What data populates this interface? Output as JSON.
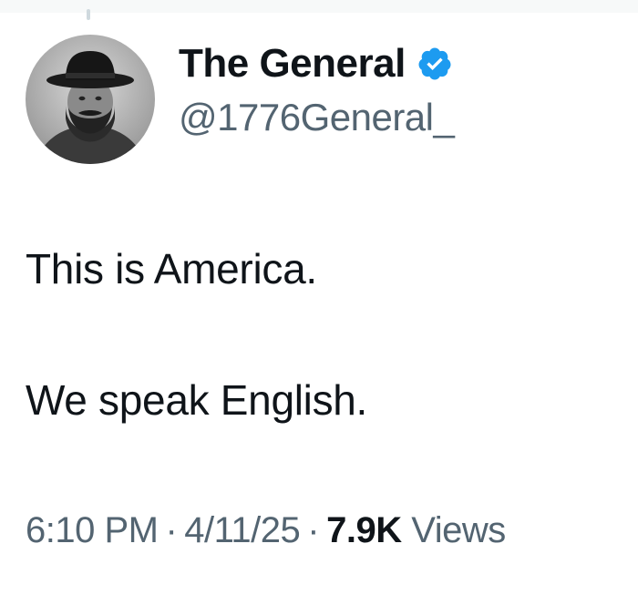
{
  "author": {
    "display_name": "The General",
    "handle": "@1776General_",
    "verified": true,
    "verified_color": "#1d9bf0",
    "avatar_icon": "bearded-man-in-hat-photo"
  },
  "tweet": {
    "line1": "This is America.",
    "line2": "We speak English."
  },
  "meta": {
    "time": "6:10 PM",
    "separator": "·",
    "date": "4/11/25",
    "views_count": "7.9K",
    "views_label": "Views"
  }
}
